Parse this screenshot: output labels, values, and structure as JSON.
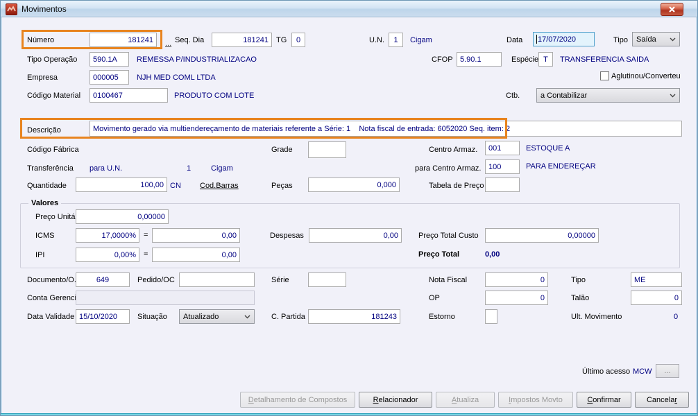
{
  "colors": {
    "highlight": "#E8841F",
    "value_navy": "#000080"
  },
  "window": {
    "title": "Movimentos"
  },
  "row1": {
    "numero_label": "Número",
    "numero_value": "181241",
    "dots": "...",
    "seqdia_label": "Seq. Dia",
    "seqdia_value": "181241",
    "tg_label": "TG",
    "tg_value": "0",
    "un_label": "U.N.",
    "un_value": "1",
    "un_desc": "Cigam",
    "data_label": "Data",
    "data_value": "17/07/2020",
    "tipo_label": "Tipo",
    "tipo_value": "Saída"
  },
  "row2": {
    "tipoop_label": "Tipo Operação",
    "tipoop_value": "590.1A",
    "tipoop_desc": "REMESSA P/INDUSTRIALIZACAO",
    "cfop_label": "CFOP",
    "cfop_value": "5.90.1",
    "especie_label": "Espécie",
    "especie_value": "T",
    "especie_desc": "TRANSFERENCIA SAIDA"
  },
  "row3": {
    "empresa_label": "Empresa",
    "empresa_value": "000005",
    "empresa_desc": "NJH MED COML LTDA",
    "aglutinou_label": "Aglutinou/Converteu"
  },
  "row4": {
    "codmat_label": "Código Material",
    "codmat_value": "0100467",
    "codmat_desc": "PRODUTO COM LOTE",
    "ctb_label": "Ctb.",
    "ctb_value": "a Contabilizar"
  },
  "descricao": {
    "label": "Descrição",
    "value": "Movimento gerado via multiendereçamento de materiais referente a Série: 1    Nota fiscal de entrada: 6052020 Seq. item: 2"
  },
  "row6": {
    "codfab_label": "Código Fábrica",
    "grade_label": "Grade",
    "centro_label": "Centro Armaz.",
    "centro_value": "001",
    "centro_desc": "ESTOQUE A"
  },
  "row7": {
    "transf_label": "Transferência",
    "paraun_label": "para U.N.",
    "paraun_value": "1",
    "paraun_desc": "Cigam",
    "paracentro_label": "para Centro Armaz.",
    "paracentro_value": "100",
    "paracentro_desc": "PARA ENDEREÇAR"
  },
  "row8": {
    "qtd_label": "Quantidade",
    "qtd_value": "100,00",
    "qtd_um": "CN",
    "codbarras_label": "Cod.Barras",
    "pecas_label": "Peças",
    "pecas_value": "0,000",
    "tabela_label": "Tabela de Preço"
  },
  "valores": {
    "legend": "Valores",
    "preco_unit_label": "Preço Unitário",
    "preco_unit_value": "0,00000",
    "icms_label": "ICMS",
    "icms_pct": "17,0000%",
    "equals": "=",
    "icms_value": "0,00",
    "despesas_label": "Despesas",
    "despesas_value": "0,00",
    "ptc_label": "Preço Total Custo",
    "ptc_value": "0,00000",
    "ipi_label": "IPI",
    "ipi_pct": "0,00%",
    "ipi_value": "0,00",
    "pt_label": "Preço Total",
    "pt_value": "0,00"
  },
  "docs": {
    "doc_label": "Documento/O.S",
    "doc_value": "649",
    "pedido_label": "Pedido/OC",
    "serie_label": "Série",
    "nf_label": "Nota Fiscal",
    "nf_value": "0",
    "tipo_label": "Tipo",
    "tipo_value": "ME",
    "conta_label": "Conta Gerencial",
    "op_label": "OP",
    "op_value": "0",
    "talao_label": "Talão",
    "talao_value": "0",
    "validade_label": "Data Validade",
    "validade_value": "15/10/2020",
    "situacao_label": "Situação",
    "situacao_value": "Atualizado",
    "cpartida_label": "C. Partida",
    "cpartida_value": "181243",
    "estorno_label": "Estorno",
    "ultmov_label": "Ult. Movimento",
    "ultmov_value": "0"
  },
  "footer": {
    "ultimo_label": "Último acesso",
    "ultimo_value": "MCW",
    "more": "..."
  },
  "buttons": [
    {
      "pre": "",
      "accel": "D",
      "post": "etalhamento de Compostos",
      "disabled": true
    },
    {
      "pre": "",
      "accel": "R",
      "post": "elacionador",
      "disabled": false
    },
    {
      "pre": "",
      "accel": "A",
      "post": "tualiza",
      "disabled": true
    },
    {
      "pre": "",
      "accel": "I",
      "post": "mpostos Movto",
      "disabled": true
    },
    {
      "pre": "",
      "accel": "C",
      "post": "onfirmar",
      "disabled": false
    },
    {
      "pre": "Cancela",
      "accel": "r",
      "post": "",
      "disabled": false
    }
  ]
}
